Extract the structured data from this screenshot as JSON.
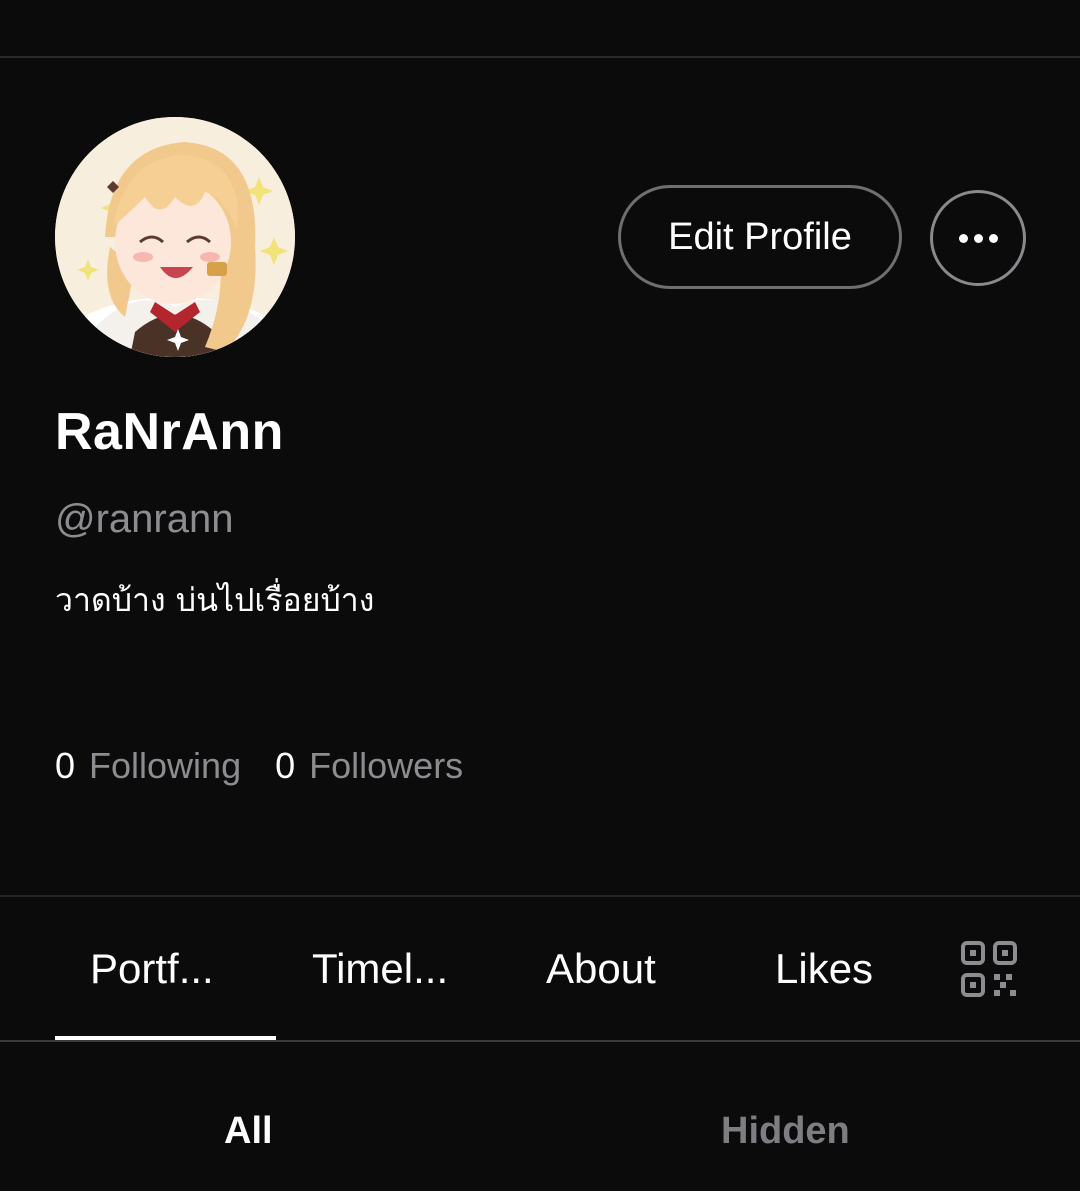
{
  "profile": {
    "display_name": "RaNrAnn",
    "handle": "@ranrann",
    "bio": "วาดบ้าง บ่นไปเรื่อยบ้าง",
    "avatar_icon": "anime-character-avatar"
  },
  "actions": {
    "edit_profile_label": "Edit Profile",
    "more_icon": "more-horizontal-icon"
  },
  "stats": {
    "following_count": "0",
    "following_label": "Following",
    "followers_count": "0",
    "followers_label": "Followers"
  },
  "tabs": [
    {
      "label": "Portf...",
      "active": true
    },
    {
      "label": "Timel...",
      "active": false
    },
    {
      "label": "About",
      "active": false
    },
    {
      "label": "Likes",
      "active": false
    }
  ],
  "tabs_extra_icon": "qr-code-icon",
  "subtabs": [
    {
      "label": "All",
      "active": true
    },
    {
      "label": "Hidden",
      "active": false
    }
  ],
  "colors": {
    "background": "#0b0b0c",
    "text_primary": "#ffffff",
    "text_secondary": "#8d8d91",
    "divider": "#2a2a2c"
  }
}
